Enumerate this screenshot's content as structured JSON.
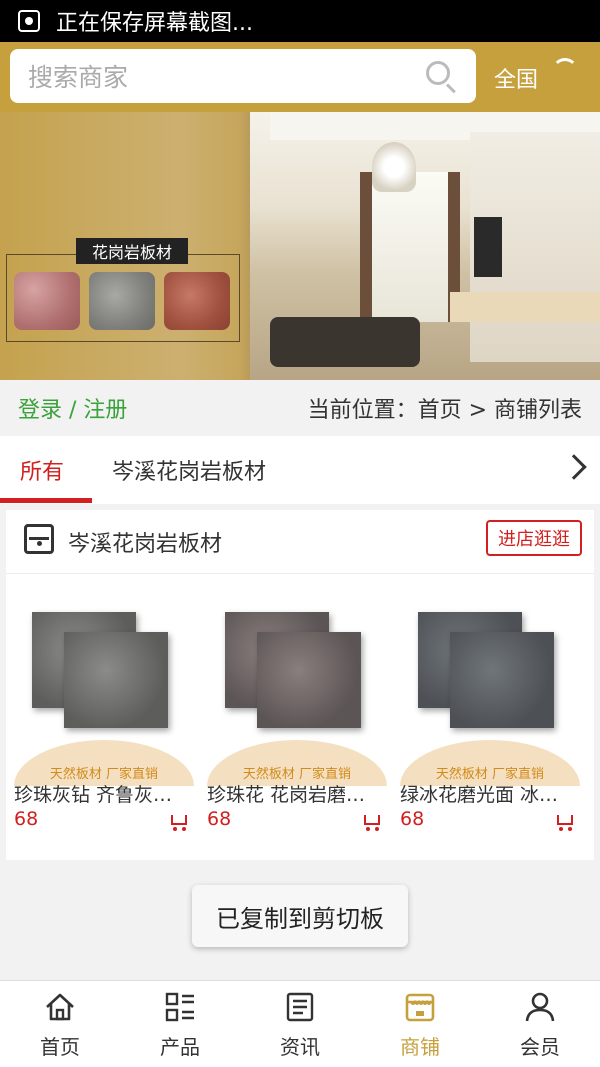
{
  "status_bar": {
    "text": "正在保存屏幕截图..."
  },
  "header": {
    "search_placeholder": "搜索商家",
    "region": "全国"
  },
  "banner": {
    "title": "花岗岩板材"
  },
  "location_bar": {
    "login": "登录 / 注册",
    "location": "当前位置：首页 > 商铺列表"
  },
  "tabs": [
    {
      "label": "所有",
      "active": true
    },
    {
      "label": "岑溪花岗岩板材",
      "active": false
    }
  ],
  "shop": {
    "name": "岑溪花岗岩板材",
    "visit_button": "进店逛逛",
    "products": [
      {
        "badge": "天然板材  厂家直销",
        "name": "珍珠灰钻 齐鲁灰…",
        "price": "68"
      },
      {
        "badge": "天然板材  厂家直销",
        "name": "珍珠花 花岗岩磨…",
        "price": "68"
      },
      {
        "badge": "天然板材  厂家直销",
        "name": "绿冰花磨光面 冰…",
        "price": "68"
      }
    ]
  },
  "toast": "已复制到剪切板",
  "bottom_nav": [
    {
      "label": "首页",
      "icon": "home-icon"
    },
    {
      "label": "产品",
      "icon": "grid-list-icon"
    },
    {
      "label": "资讯",
      "icon": "news-icon"
    },
    {
      "label": "商铺",
      "icon": "store-icon",
      "active": true
    },
    {
      "label": "会员",
      "icon": "user-icon"
    }
  ],
  "colors": {
    "brand": "#c5a03c",
    "accent_red": "#d21f1f",
    "login_green": "#3aa23a"
  }
}
